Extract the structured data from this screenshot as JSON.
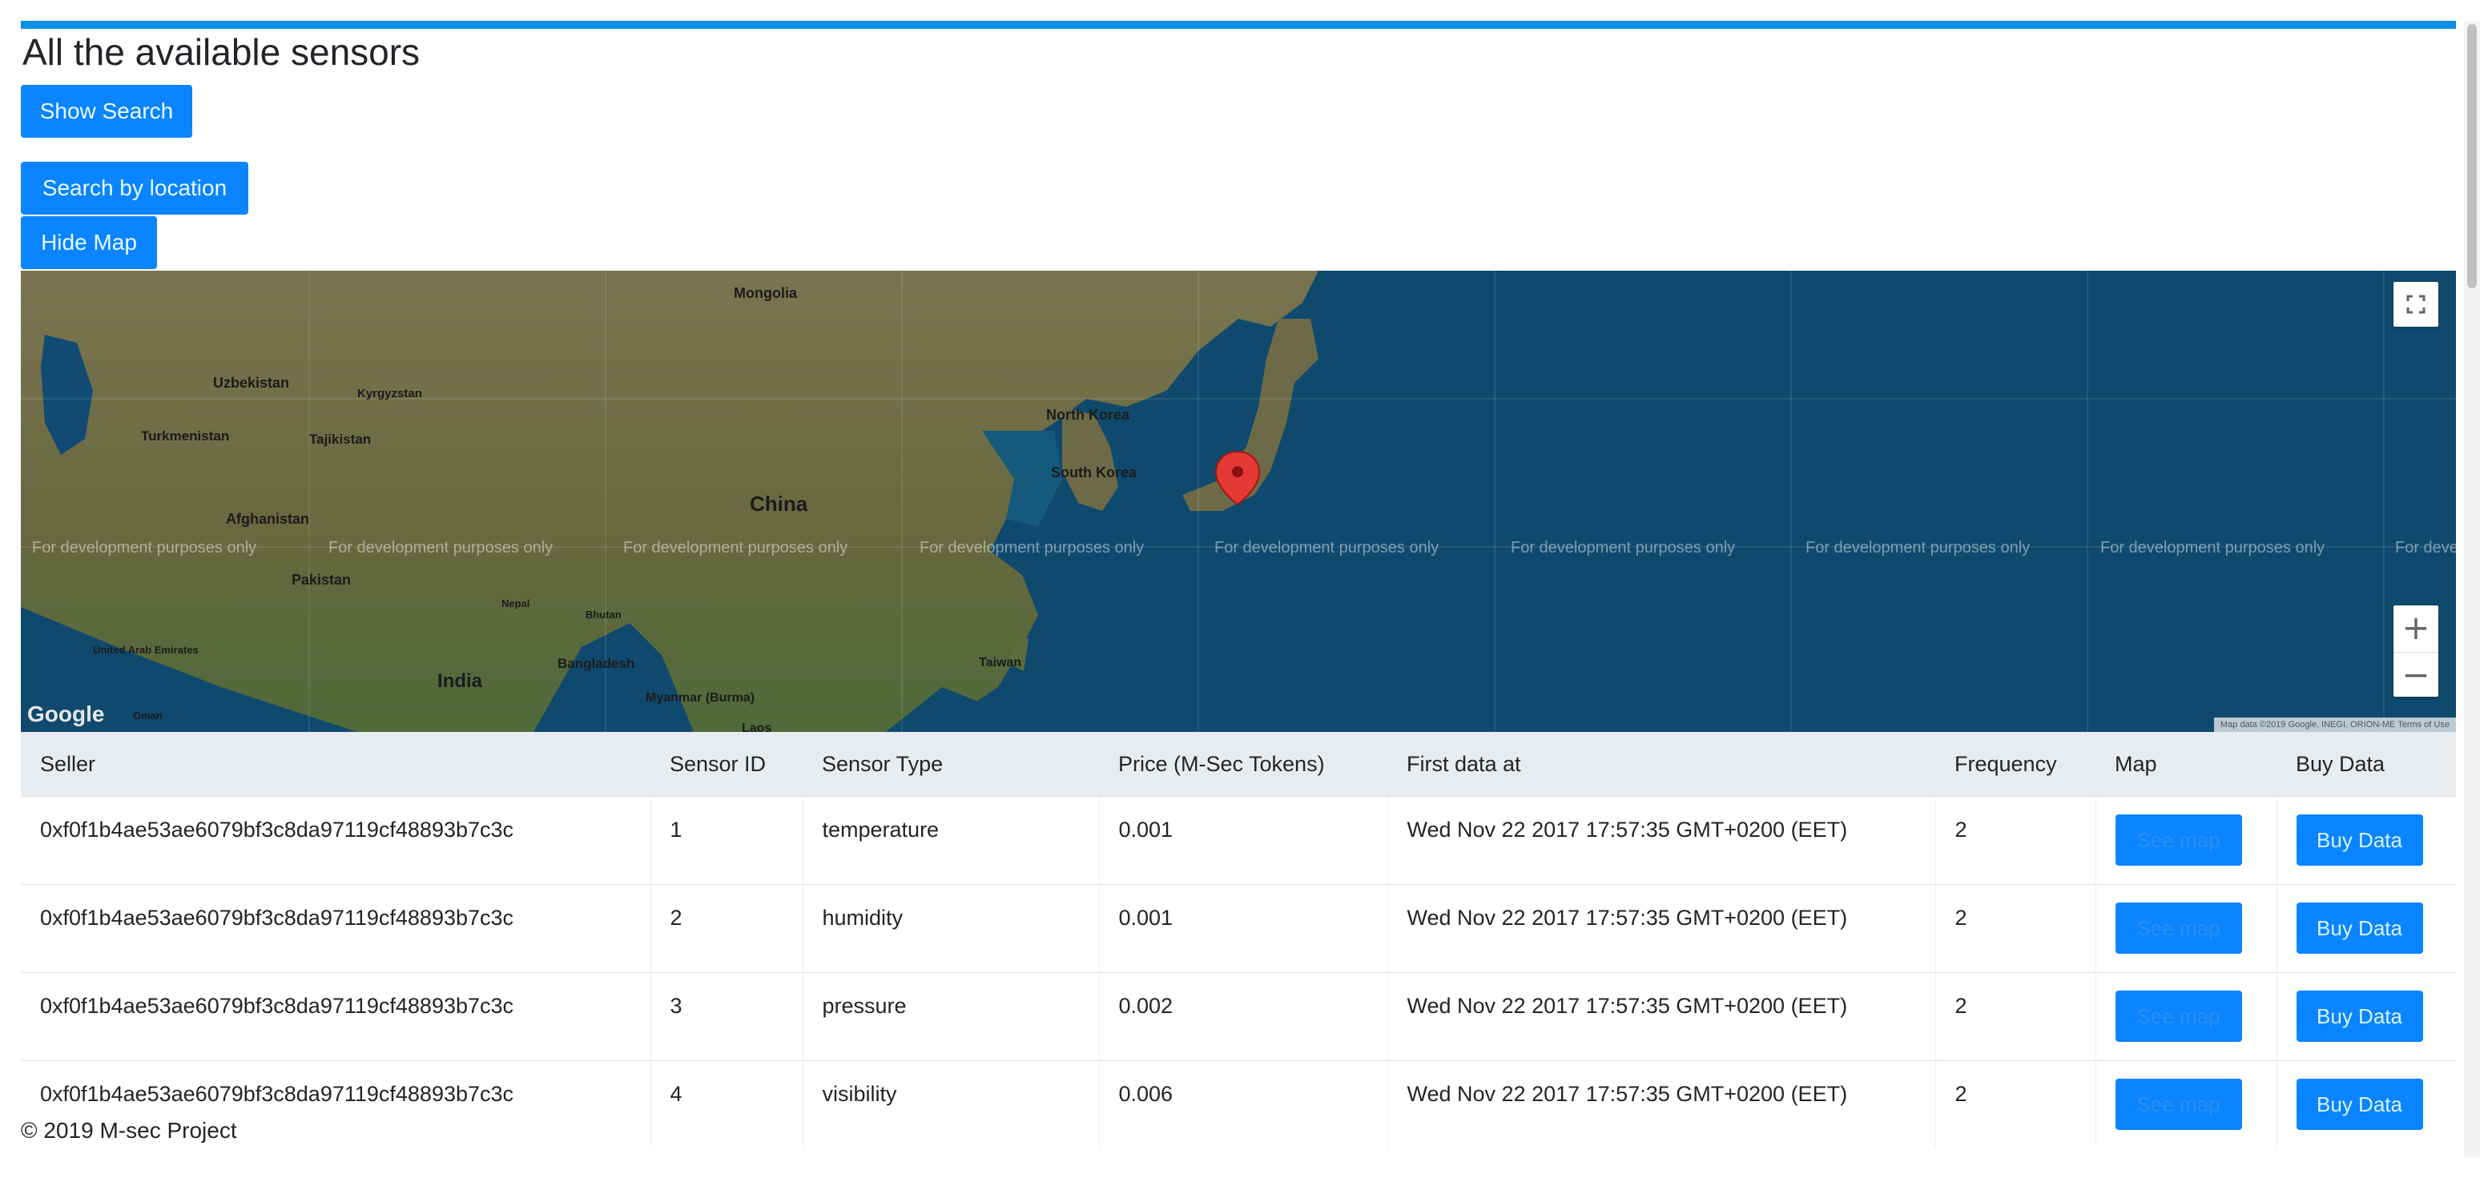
{
  "page": {
    "title": "All the available sensors",
    "footer": "© 2019 M-sec Project"
  },
  "buttons": {
    "show_search": "Show Search",
    "search_by_location": "Search by location",
    "hide_map": "Hide Map"
  },
  "map": {
    "watermark": "For development purposes only",
    "labels": [
      "Mongolia",
      "Uzbekistan",
      "Kyrgyzstan",
      "Turkmenistan",
      "Tajikistan",
      "North Korea",
      "South Korea",
      "China",
      "Afghanistan",
      "Pakistan",
      "India",
      "Bangladesh",
      "Myanmar (Burma)",
      "Taiwan",
      "United Arab Emirates",
      "Nepal",
      "Bhutan",
      "Oman",
      "Laos"
    ],
    "attribution": "Map data ©2019 Google, INEGI, ORION-ME  Terms of Use",
    "logo": "Google",
    "zoom_in": "+",
    "zoom_out": "−",
    "marker_icon": "map-pin-icon",
    "fullscreen_icon": "fullscreen-icon"
  },
  "table": {
    "headers": [
      "Seller",
      "Sensor ID",
      "Sensor Type",
      "Price (M-Sec Tokens)",
      "First data at",
      "Frequency",
      "Map",
      "Buy Data"
    ],
    "see_map_label": "See map",
    "buy_label": "Buy Data",
    "rows": [
      {
        "seller": "0xf0f1b4ae53ae6079bf3c8da97119cf48893b7c3c",
        "sensor_id": "1",
        "sensor_type": "temperature",
        "price": "0.001",
        "first_data_at": "Wed Nov 22 2017 17:57:35 GMT+0200 (EET)",
        "frequency": "2"
      },
      {
        "seller": "0xf0f1b4ae53ae6079bf3c8da97119cf48893b7c3c",
        "sensor_id": "2",
        "sensor_type": "humidity",
        "price": "0.001",
        "first_data_at": "Wed Nov 22 2017 17:57:35 GMT+0200 (EET)",
        "frequency": "2"
      },
      {
        "seller": "0xf0f1b4ae53ae6079bf3c8da97119cf48893b7c3c",
        "sensor_id": "3",
        "sensor_type": "pressure",
        "price": "0.002",
        "first_data_at": "Wed Nov 22 2017 17:57:35 GMT+0200 (EET)",
        "frequency": "2"
      },
      {
        "seller": "0xf0f1b4ae53ae6079bf3c8da97119cf48893b7c3c",
        "sensor_id": "4",
        "sensor_type": "visibility",
        "price": "0.006",
        "first_data_at": "Wed Nov 22 2017 17:57:35 GMT+0200 (EET)",
        "frequency": "2"
      }
    ]
  },
  "colors": {
    "accent": "#0c8fe6",
    "button": "#0a84ff",
    "ocean": "#0f4a6e",
    "land": "#6b6a45",
    "marker": "#e53935"
  }
}
